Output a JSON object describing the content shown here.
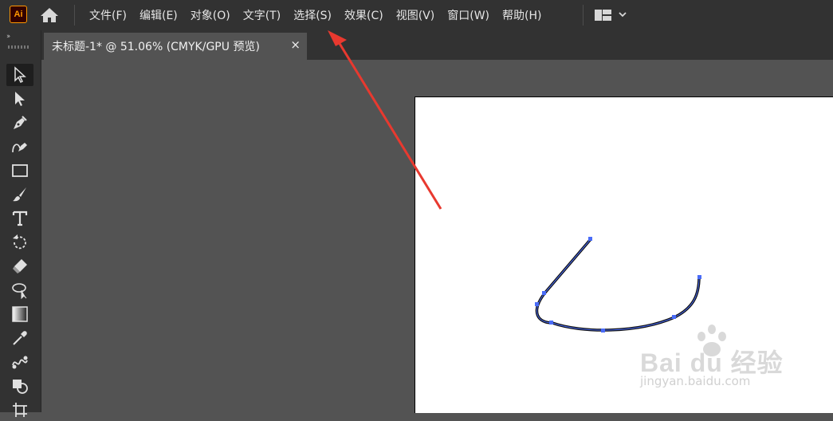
{
  "app": {
    "logo_text": "Ai"
  },
  "menu": {
    "items": [
      "文件(F)",
      "编辑(E)",
      "对象(O)",
      "文字(T)",
      "选择(S)",
      "效果(C)",
      "视图(V)",
      "窗口(W)",
      "帮助(H)"
    ]
  },
  "document": {
    "tab_title": "未标题-1* @ 51.06% (CMYK/GPU 预览)",
    "close_glyph": "×"
  },
  "toolbar": {
    "collapse_glyph": "››",
    "tools": [
      "selection-tool",
      "direct-selection-tool",
      "pen-tool",
      "curvature-tool",
      "rectangle-tool",
      "paintbrush-tool",
      "type-tool",
      "rotate-tool",
      "eraser-tool",
      "lasso-tool",
      "gradient-tool",
      "eyedropper-tool",
      "blend-tool",
      "shape-builder-tool",
      "artboard-tool"
    ]
  },
  "watermark": {
    "brand": "Bai du 经验",
    "url": "jingyan.baidu.com"
  },
  "colors": {
    "annotation_arrow": "#e8392f",
    "path_stroke": "#111111",
    "anchor": "#4a6cf7",
    "logo_accent": "#ff9a00"
  }
}
